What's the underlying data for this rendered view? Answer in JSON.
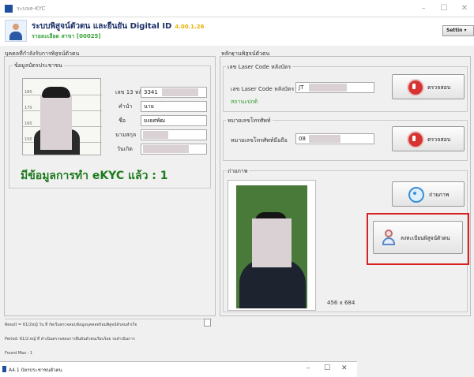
{
  "window": {
    "title": "ระบบe-KYC",
    "controls": {
      "minimize": "–",
      "maximize": "☐",
      "close": "✕"
    }
  },
  "header": {
    "title": "ระบบพิสูจน์ตัวตน และยืนยัน Digital ID",
    "version": "4.00.1.26",
    "subtitle": "รายละเอียด สาขา [00025]",
    "settings_label": "Settin ▾"
  },
  "left_panel": {
    "section_title": "บุคคลที่กำลังรับการพิสูจน์ตัวตน",
    "group_title": "ข้อมูลบัตรประชาชน",
    "fields": [
      {
        "label": "เลข 13 หลัก",
        "value": "3341"
      },
      {
        "label": "คำนำ",
        "value": "นาย"
      },
      {
        "label": "ชื่อ",
        "value": "ยงยศพัฒ"
      },
      {
        "label": "นามสกุล",
        "value": ""
      },
      {
        "label": "วันเกิด",
        "value": ""
      }
    ],
    "status_big": "มีข้อมูลการทำ eKYC แล้ว : 1"
  },
  "right_panel": {
    "section_title": "หลักฐานพิสูจน์ตัวตน",
    "laser_group": {
      "title": "เลข Laser Code หลังบัตร",
      "label": "เลข Laser Code หลังบัตร",
      "value": "JT",
      "status": "สถานะปกติ",
      "button": "ตรวจสอบ"
    },
    "phone_group": {
      "title": "หมายเลขโทรศัพท์",
      "label": "หมายเลขโทรศัพท์มือถือ",
      "value": "08",
      "button": "ตรวจสอบ"
    },
    "photo_group": {
      "title": "ถ่ายภาพ",
      "size_label": "456 x 684",
      "capture_button": "ถ่ายภาพ",
      "register_button": "ลงทะเบียนพิสูจน์ตัวตน"
    }
  },
  "log": {
    "lines": [
      "Result = 61/2หญ์ วัน ที่ กัตเริ่มตรวจสอบข้อมูลบุคคลพร้อมพิสูจน์ตัวตนสำเร็จ",
      "Period: 61/2:หญ์ ที่ ดำเนินตรวจสอบการยืนยันตัวตนเรียบร้อย รอดำเนินการ",
      "Found Max : 1"
    ]
  },
  "taskbar": {
    "title": "A4.1 บัตรประชาชนตัวตน",
    "controls": {
      "minimize": "–",
      "maximize": "☐",
      "close": "✕"
    }
  },
  "colors": {
    "accent_red": "#d92020",
    "status_green": "#1d7a1d",
    "header_navy": "#1b2f66",
    "version_gold": "#e8b100"
  }
}
